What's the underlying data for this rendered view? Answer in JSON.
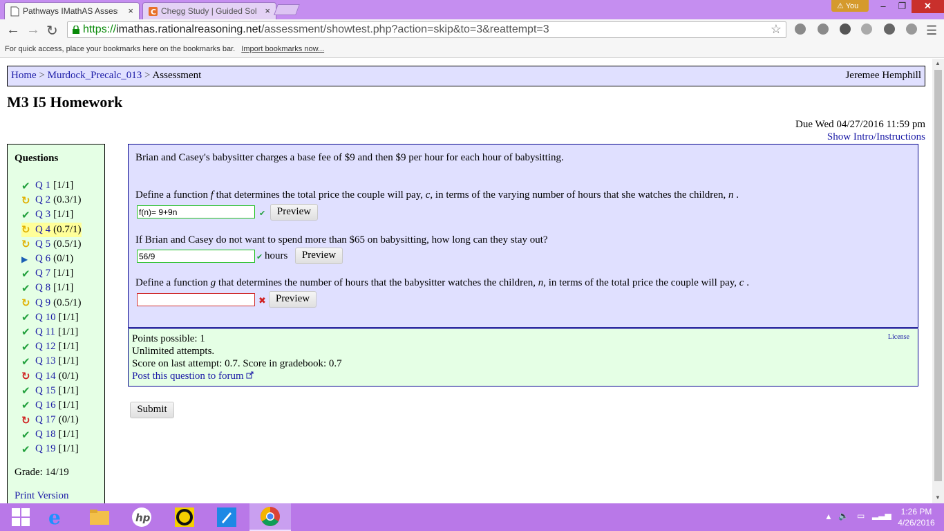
{
  "browser": {
    "tabs": [
      {
        "title": "Pathways IMathAS Assess",
        "close": "×",
        "active": true
      },
      {
        "title": "Chegg Study | Guided Sol",
        "close": "×",
        "active": false
      }
    ],
    "profile": "You",
    "window_controls": {
      "minimize": "–",
      "maximize": "❐",
      "close": "✕"
    },
    "url": {
      "scheme": "https://",
      "host": "imathas.rationalreasoning.net",
      "path": "/assessment/showtest.php?action=skip&to=3&reattempt=3"
    },
    "bookmarks_bar": {
      "message": "For quick access, place your bookmarks here on the bookmarks bar.",
      "link": "Import bookmarks now..."
    }
  },
  "breadcrumb": {
    "items": [
      "Home",
      "Murdock_Precalc_013"
    ],
    "separator": ">",
    "current": "Assessment",
    "user": "Jeremee Hemphill"
  },
  "page_title": "M3 I5 Homework",
  "due": "Due Wed 04/27/2016 11:59 pm",
  "show_intro": "Show Intro/Instructions",
  "sidebar": {
    "heading": "Questions",
    "items": [
      {
        "label": "Q 1",
        "score": "[1/1]",
        "status": "correct"
      },
      {
        "label": "Q 2",
        "score": "(0.3/1)",
        "status": "partial"
      },
      {
        "label": "Q 3",
        "score": "[1/1]",
        "status": "correct"
      },
      {
        "label": "Q 4",
        "score": "(0.7/1)",
        "status": "partial",
        "current": true
      },
      {
        "label": "Q 5",
        "score": "(0.5/1)",
        "status": "partial"
      },
      {
        "label": "Q 6",
        "score": "(0/1)",
        "status": "unattempted"
      },
      {
        "label": "Q 7",
        "score": "[1/1]",
        "status": "correct"
      },
      {
        "label": "Q 8",
        "score": "[1/1]",
        "status": "correct"
      },
      {
        "label": "Q 9",
        "score": "(0.5/1)",
        "status": "partial"
      },
      {
        "label": "Q 10",
        "score": "[1/1]",
        "status": "correct"
      },
      {
        "label": "Q 11",
        "score": "[1/1]",
        "status": "correct"
      },
      {
        "label": "Q 12",
        "score": "[1/1]",
        "status": "correct"
      },
      {
        "label": "Q 13",
        "score": "[1/1]",
        "status": "correct"
      },
      {
        "label": "Q 14",
        "score": "(0/1)",
        "status": "wrong"
      },
      {
        "label": "Q 15",
        "score": "[1/1]",
        "status": "correct"
      },
      {
        "label": "Q 16",
        "score": "[1/1]",
        "status": "correct"
      },
      {
        "label": "Q 17",
        "score": "(0/1)",
        "status": "wrong"
      },
      {
        "label": "Q 18",
        "score": "[1/1]",
        "status": "correct"
      },
      {
        "label": "Q 19",
        "score": "[1/1]",
        "status": "correct"
      }
    ],
    "grade": "Grade: 14/19",
    "print": "Print Version"
  },
  "question": {
    "intro": "Brian and Casey's babysitter charges a base fee of $9 and then $9 per hour for each hour of babysitting.",
    "part1": {
      "prompt_a": "Define a function",
      "fn": "f",
      "prompt_b": "that determines the total price the couple will pay,",
      "var_c": "c,",
      "prompt_c": "in terms of the varying number of hours that she watches the children,",
      "var_n": "n",
      "prompt_d": ".",
      "value": "f(n)= 9+9n",
      "button": "Preview"
    },
    "part2": {
      "prompt": "If Brian and Casey do not want to spend more than $65 on babysitting, how long can they stay out?",
      "value": "56/9",
      "unit": "hours",
      "button": "Preview"
    },
    "part3": {
      "prompt_a": "Define a function",
      "fn": "g",
      "prompt_b": "that determines the number of hours that the babysitter watches the children,",
      "var_n": "n",
      "prompt_c": ", in terms of the total price the couple will pay,",
      "var_c": "c",
      "prompt_d": ".",
      "value": "",
      "button": "Preview"
    }
  },
  "info": {
    "points": "Points possible: 1",
    "attempts": "Unlimited attempts.",
    "score": "Score on last attempt: 0.7. Score in gradebook: 0.7",
    "forum": "Post this question to forum",
    "license": "License"
  },
  "submit": "Submit",
  "taskbar": {
    "time": "1:26 PM",
    "date": "4/26/2016"
  },
  "colors": {
    "titlebar": "#c58ef0",
    "taskbar": "#b978e8",
    "question_bg": "#e0e0ff",
    "sidebar_bg": "#e5ffe5",
    "link": "#1a1aa6",
    "correct": "#21a03c",
    "partial": "#e0b000",
    "wrong": "#d02020"
  }
}
